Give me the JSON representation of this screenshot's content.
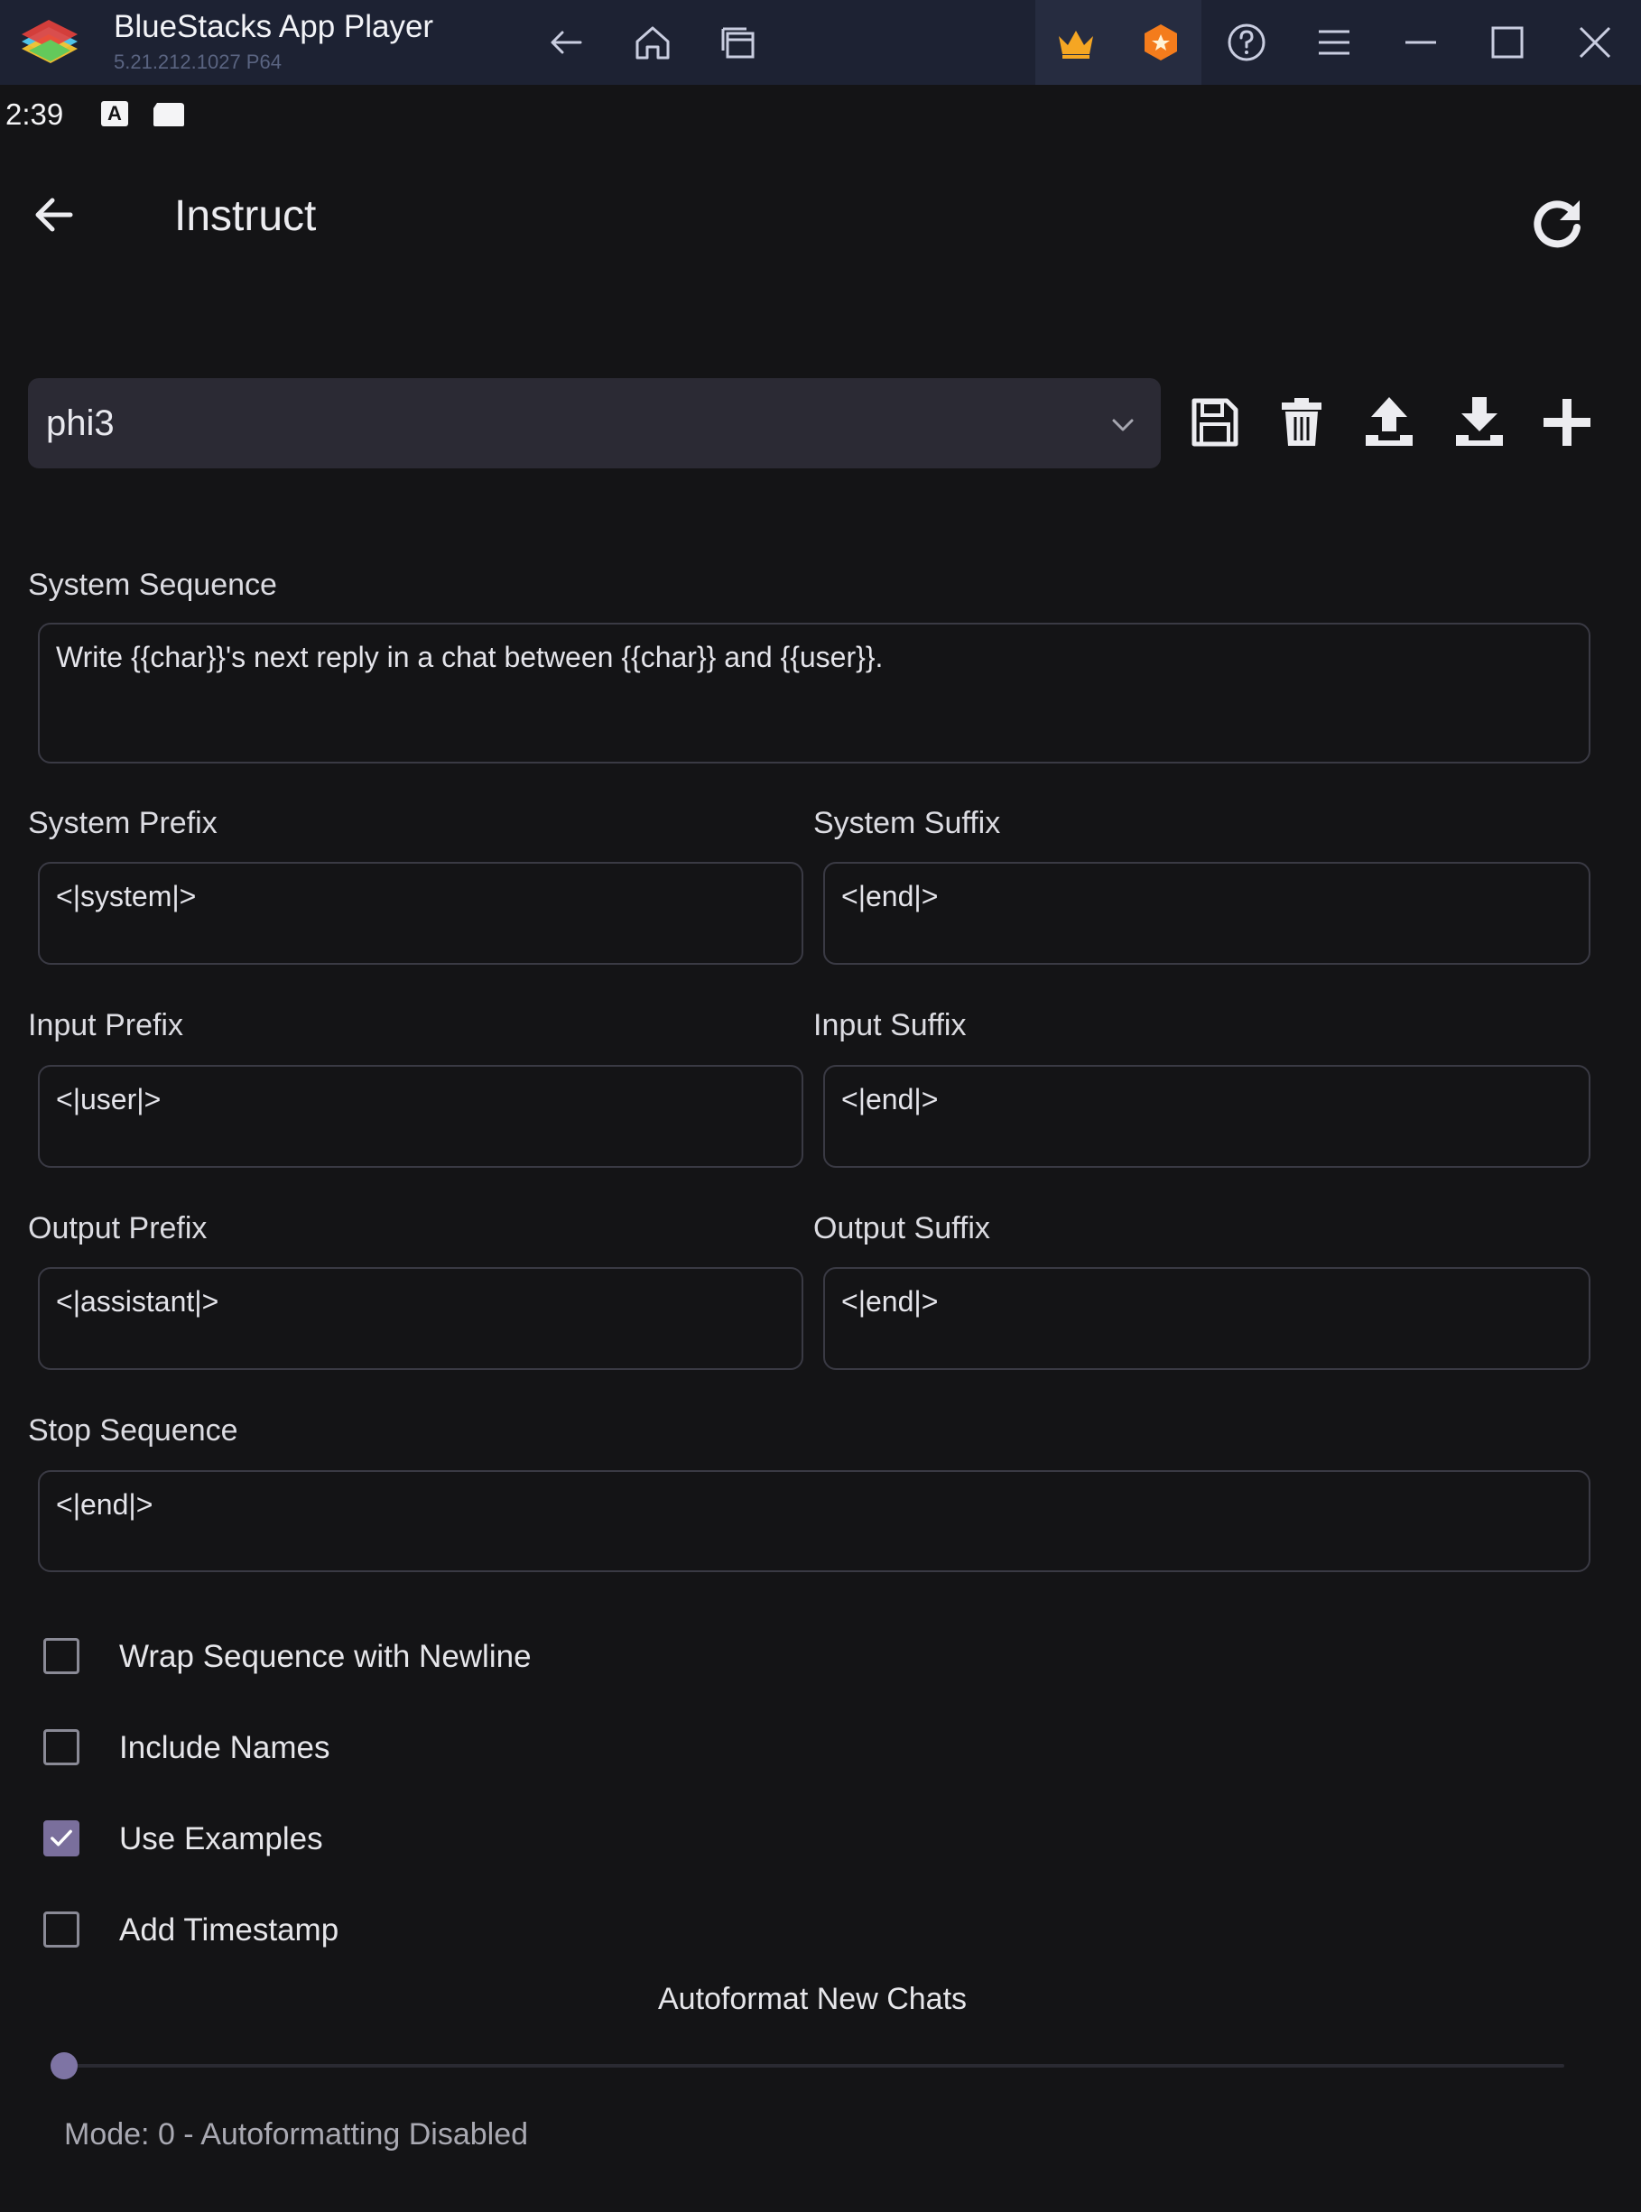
{
  "window": {
    "title": "BlueStacks App Player",
    "version": "5.21.212.1027  P64"
  },
  "status_bar": {
    "time": "2:39",
    "a_icon": "A"
  },
  "header": {
    "title": "Instruct"
  },
  "preset": {
    "selected": "phi3"
  },
  "fields": {
    "system_sequence": {
      "label": "System Sequence",
      "value": "Write {{char}}'s next reply in a chat between {{char}} and {{user}}."
    },
    "system_prefix": {
      "label": "System Prefix",
      "value": "<|system|>"
    },
    "system_suffix": {
      "label": "System Suffix",
      "value": "<|end|>"
    },
    "input_prefix": {
      "label": "Input Prefix",
      "value": "<|user|>"
    },
    "input_suffix": {
      "label": "Input Suffix",
      "value": "<|end|>"
    },
    "output_prefix": {
      "label": "Output Prefix",
      "value": "<|assistant|>"
    },
    "output_suffix": {
      "label": "Output Suffix",
      "value": "<|end|>"
    },
    "stop_sequence": {
      "label": "Stop Sequence",
      "value": "<|end|>"
    }
  },
  "checkboxes": [
    {
      "label": "Wrap Sequence with Newline",
      "checked": false
    },
    {
      "label": "Include Names",
      "checked": false
    },
    {
      "label": "Use Examples",
      "checked": true
    },
    {
      "label": "Add Timestamp",
      "checked": false
    }
  ],
  "autoformat": {
    "title": "Autoformat New Chats",
    "mode_text": "Mode: 0 - Autoformatting Disabled",
    "level": 0
  },
  "colors": {
    "accent": "#7a6f9c",
    "titlebar": "#1d2233",
    "background": "#141416"
  },
  "icons": [
    "back-arrow-icon",
    "home-icon",
    "recent-apps-icon",
    "crown-icon",
    "badge-icon",
    "help-icon",
    "menu-icon",
    "minimize-icon",
    "maximize-icon",
    "close-icon",
    "refresh-icon",
    "save-icon",
    "trash-icon",
    "upload-icon",
    "download-icon",
    "plus-icon",
    "chevron-down-icon",
    "check-icon"
  ]
}
